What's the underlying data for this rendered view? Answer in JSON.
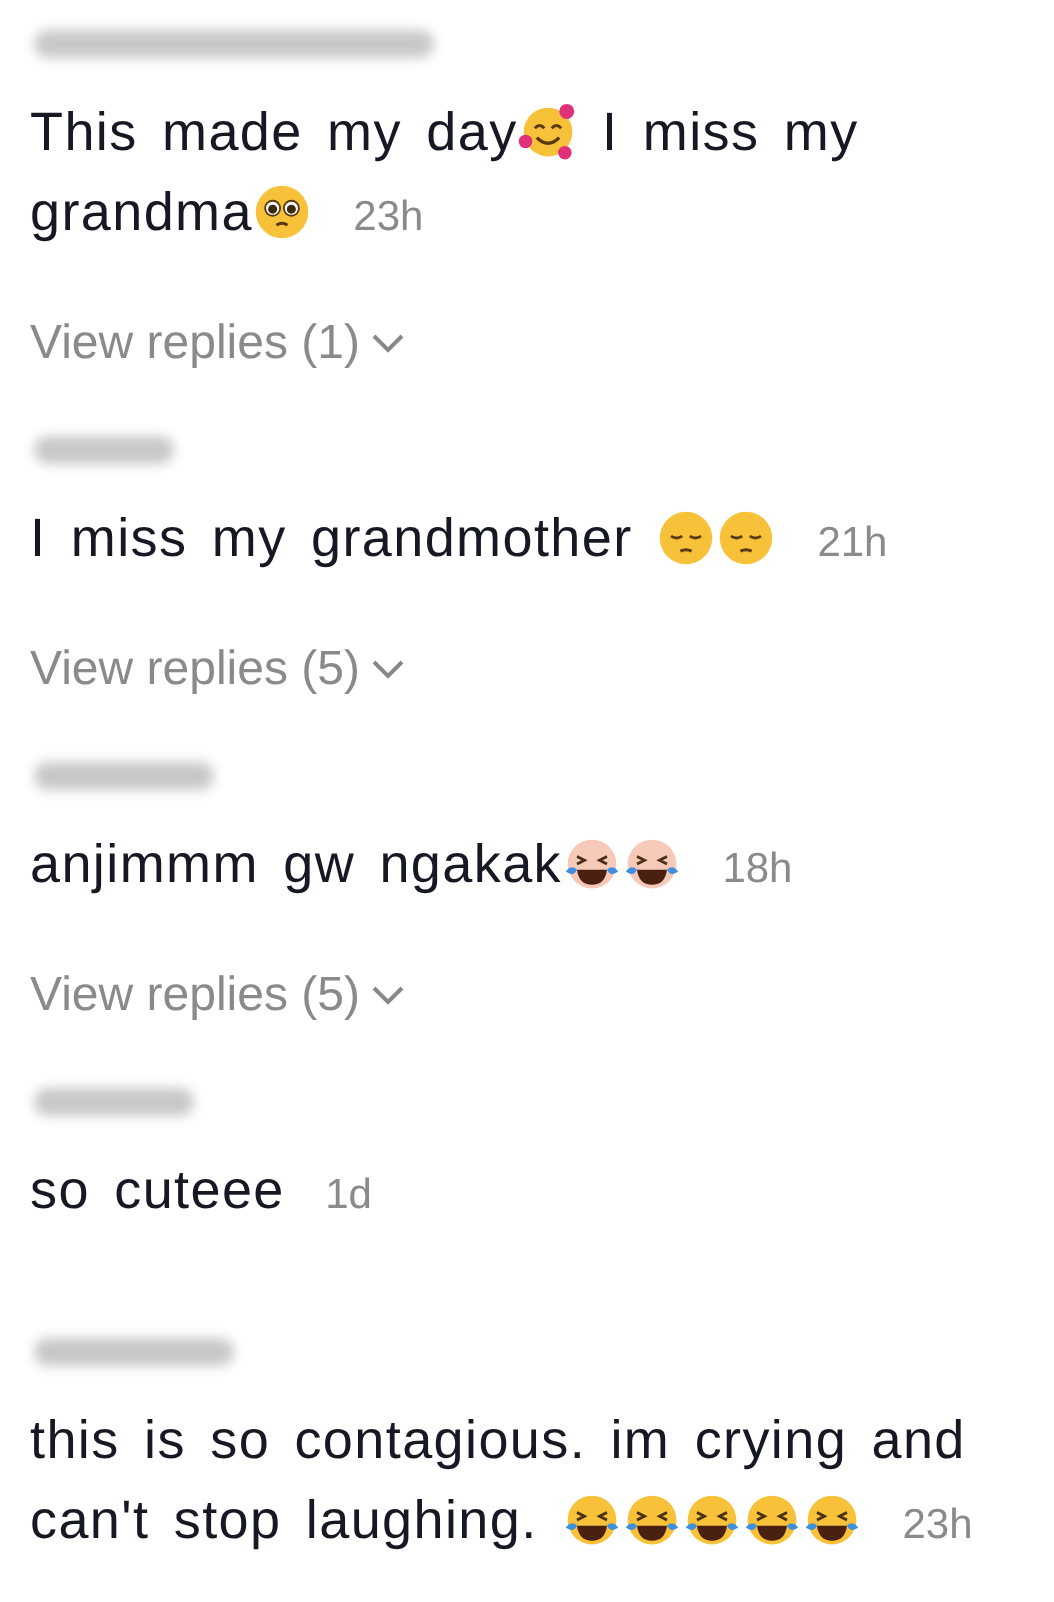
{
  "comments": [
    {
      "parts": [
        {
          "kind": "text",
          "text": "This made my day"
        },
        {
          "kind": "hearts"
        },
        {
          "kind": "text",
          "text": " I miss my"
        },
        {
          "kind": "text",
          "text": "grandma"
        },
        {
          "kind": "pleading"
        }
      ],
      "time": "23h",
      "replies": "View replies (1)"
    },
    {
      "parts": [
        {
          "kind": "text",
          "text": "I miss my grandmother "
        },
        {
          "kind": "pensive"
        },
        {
          "kind": "pensive"
        }
      ],
      "time": "21h",
      "replies": "View replies (5)"
    },
    {
      "parts": [
        {
          "kind": "text",
          "text": "anjimmm gw ngakak"
        },
        {
          "kind": "laughpale"
        },
        {
          "kind": "laughpale"
        }
      ],
      "time": "18h",
      "replies": "View replies (5)"
    },
    {
      "parts": [
        {
          "kind": "text",
          "text": "so cuteee"
        }
      ],
      "time": "1d"
    },
    {
      "parts": [
        {
          "kind": "text",
          "text": "this is so contagious. im crying and"
        },
        {
          "kind": "text",
          "text": "can't stop laughing. "
        },
        {
          "kind": "laugh"
        },
        {
          "kind": "laugh"
        },
        {
          "kind": "laugh"
        },
        {
          "kind": "laugh"
        },
        {
          "kind": "laugh"
        }
      ],
      "time": "23h"
    }
  ]
}
